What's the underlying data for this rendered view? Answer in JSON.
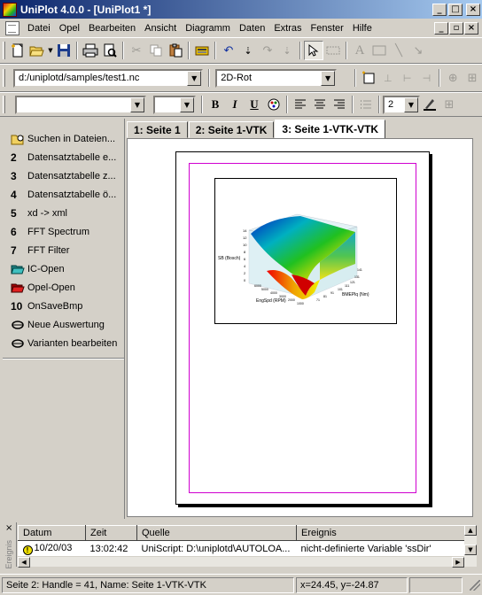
{
  "window": {
    "title": "UniPlot 4.0.0 - [UniPlot1 *]",
    "controls": [
      "_",
      "□",
      "×"
    ]
  },
  "menu": {
    "items": [
      "Datei",
      "Opel",
      "Bearbeiten",
      "Ansicht",
      "Diagramm",
      "Daten",
      "Extras",
      "Fenster",
      "Hilfe"
    ],
    "mdi_controls": [
      "_",
      "▫",
      "×"
    ]
  },
  "toolbar1": {
    "icons": [
      "new-icon",
      "open-icon",
      "save-icon",
      "print-icon",
      "print-preview-icon",
      "cut-icon",
      "copy-icon",
      "paste-icon",
      "calculator-icon",
      "undo-icon",
      "import-icon",
      "redo-icon",
      "export-icon",
      "select-icon",
      "rectangle-icon",
      "text-icon",
      "frame-icon",
      "line-icon",
      "arrow-icon"
    ]
  },
  "toolbar2": {
    "file_combo_value": "d:/uniplotd/samples/test1.nc",
    "style_combo_value": "2D-Rot"
  },
  "toolbar3": {
    "font_combo_value": "",
    "size_combo_value": "",
    "line_width_value": "2"
  },
  "sidebar": {
    "items": [
      {
        "num": "",
        "icon": "search-folder-icon",
        "label": "Suchen in Dateien..."
      },
      {
        "num": "2",
        "icon": "",
        "label": "Datensatztabelle e..."
      },
      {
        "num": "3",
        "icon": "",
        "label": "Datensatztabelle z..."
      },
      {
        "num": "4",
        "icon": "",
        "label": "Datensatztabelle ö..."
      },
      {
        "num": "5",
        "icon": "",
        "label": "xd -> xml"
      },
      {
        "num": "6",
        "icon": "",
        "label": "FFT Spectrum"
      },
      {
        "num": "7",
        "icon": "",
        "label": "FFT Filter"
      },
      {
        "num": "",
        "icon": "folder-open-teal-icon",
        "label": "IC-Open"
      },
      {
        "num": "",
        "icon": "folder-open-red-icon",
        "label": "Opel-Open"
      },
      {
        "num": "10",
        "icon": "",
        "label": "OnSaveBmp"
      },
      {
        "num": "",
        "icon": "script-icon",
        "label": "Neue Auswertung"
      },
      {
        "num": "",
        "icon": "script-icon",
        "label": "Varianten bearbeiten"
      }
    ]
  },
  "tabs": [
    {
      "label": "1: Seite 1",
      "active": false
    },
    {
      "label": "2: Seite 1-VTK",
      "active": false
    },
    {
      "label": "3: Seite 1-VTK-VTK",
      "active": true
    }
  ],
  "plot": {
    "z_axis_label": "SB (Bosch)",
    "x_axis_label": "EngSpd (RPM)",
    "y_axis_label": "BMEPlq (Nm)",
    "z_ticks": [
      "14",
      "12",
      "10",
      "8",
      "6",
      "4",
      "2",
      "0"
    ],
    "x_ticks": [
      "1000",
      "2000",
      "3000",
      "4000",
      "5000",
      "6000"
    ],
    "y_ticks": [
      "141",
      "131",
      "121",
      "111",
      "101",
      "91",
      "81",
      "71"
    ]
  },
  "event_log": {
    "side_title": "Ereignis",
    "columns": [
      "Datum",
      "Zeit",
      "Quelle",
      "Ereignis"
    ],
    "rows": [
      {
        "datum": "10/20/03",
        "zeit": "13:02:42",
        "quelle": "UniScript: D:\\uniplotd\\AUTOLOA...",
        "ereignis": "nicht-definierte Variable 'ssDir'"
      }
    ]
  },
  "status": {
    "left": "Seite 2: Handle = 41, Name: Seite 1-VTK-VTK",
    "middle": "",
    "coords": "x=24.45, y=-24.87"
  },
  "colors": {
    "titlebar_start": "#0a246a",
    "titlebar_end": "#a6caf0",
    "page_frame": "#d000d0",
    "chrome": "#d4d0c8"
  }
}
